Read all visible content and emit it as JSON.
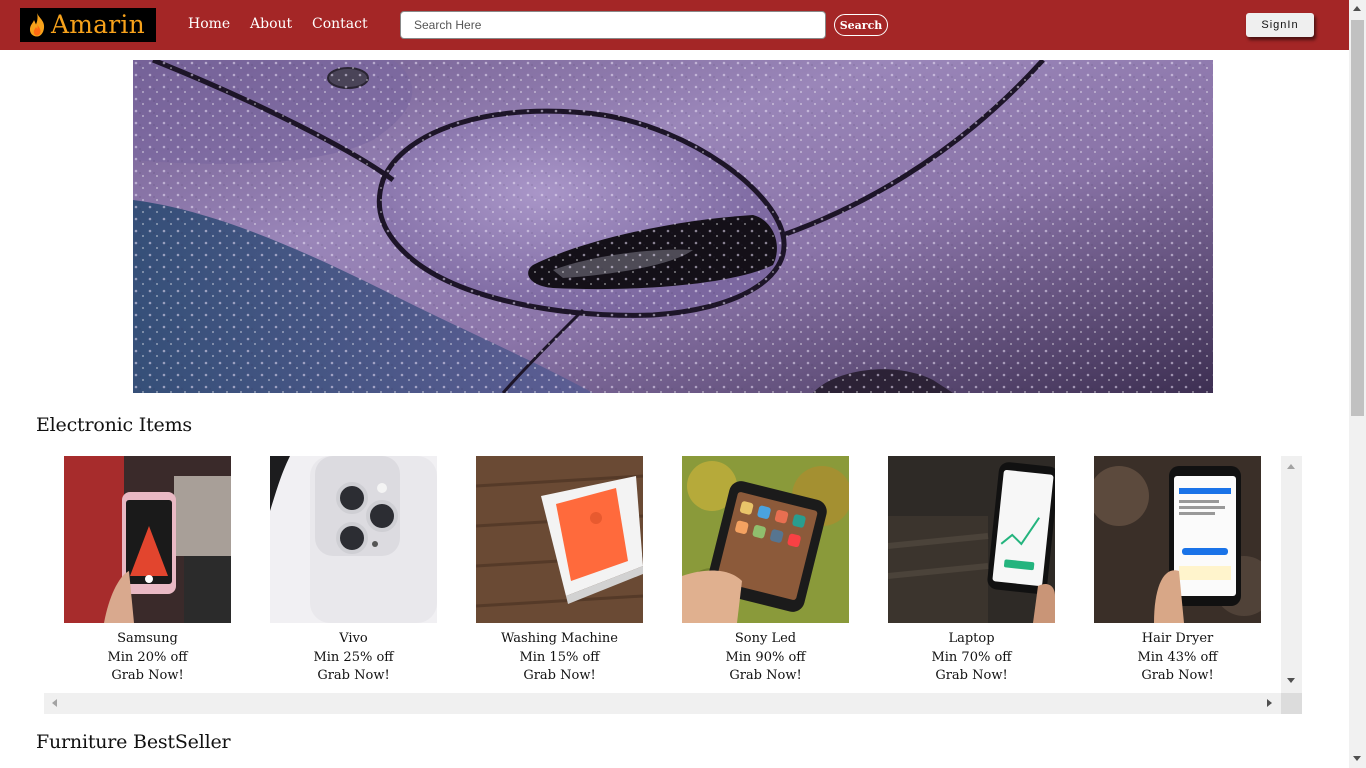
{
  "navbar": {
    "brand": "Amarin",
    "links": [
      "Home",
      "About",
      "Contact"
    ],
    "search_placeholder": "Search Here",
    "search_button": "Search",
    "signin_button": "SignIn",
    "background_color": "#a42626",
    "brand_color": "#f7a21b"
  },
  "hero": {
    "image": "car-headlight-with-raindrops"
  },
  "sections": [
    {
      "title": "Electronic Items",
      "items": [
        {
          "name": "Samsung",
          "offer": "Min 20% off",
          "cta": "Grab Now!",
          "image": "hand-holding-pink-iphone-camera"
        },
        {
          "name": "Vivo",
          "offer": "Min 25% off",
          "cta": "Grab Now!",
          "image": "white-iphone-triple-camera"
        },
        {
          "name": "Washing Machine",
          "offer": "Min 15% off",
          "cta": "Grab Now!",
          "image": "orange-iphone-in-box"
        },
        {
          "name": "Sony Led",
          "offer": "Min 90% off",
          "cta": "Grab Now!",
          "image": "hand-holding-iphone-homescreen"
        },
        {
          "name": "Laptop",
          "offer": "Min 70% off",
          "cta": "Grab Now!",
          "image": "phone-showing-stock-chart"
        },
        {
          "name": "Hair Dryer",
          "offer": "Min 43% off",
          "cta": "Grab Now!",
          "image": "phone-showing-screening-tool"
        }
      ]
    },
    {
      "title": "Furniture BestSeller",
      "items": []
    }
  ]
}
